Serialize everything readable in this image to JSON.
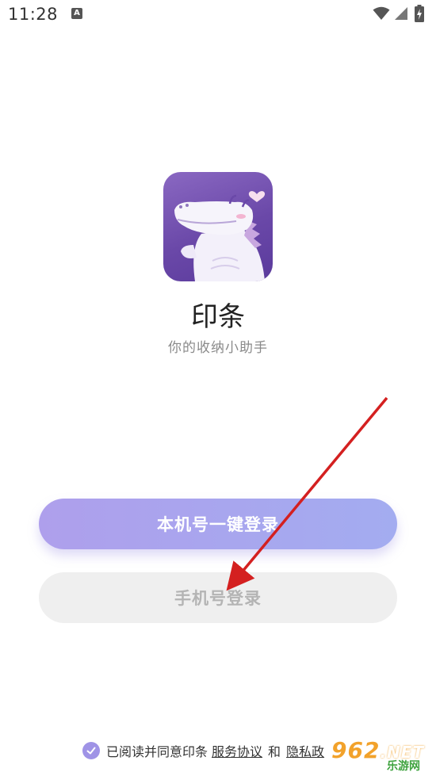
{
  "status_bar": {
    "time": "11:28",
    "notification_badge": "A",
    "icons": [
      "wifi-icon",
      "signal-icon",
      "battery-charging-icon"
    ]
  },
  "app": {
    "name": "印条",
    "slogan": "你的收纳小助手",
    "logo_icon": "crocodile-mascot-icon"
  },
  "buttons": {
    "one_click_login": "本机号一键登录",
    "phone_login": "手机号登录"
  },
  "agreement": {
    "prefix": "已阅读并同意印条",
    "service_link": "服务协议",
    "conjunction": "和",
    "privacy_link": "隐私政"
  },
  "watermark": {
    "number": "962",
    "suffix": ".NET",
    "text": "乐游网"
  },
  "colors": {
    "primary_gradient_start": "#ae9fec",
    "primary_gradient_end": "#a3acf0",
    "secondary_bg": "#efefef",
    "accent": "#9f93e6",
    "logo_bg": "#6a48a8",
    "annotation_arrow": "#d42020"
  }
}
